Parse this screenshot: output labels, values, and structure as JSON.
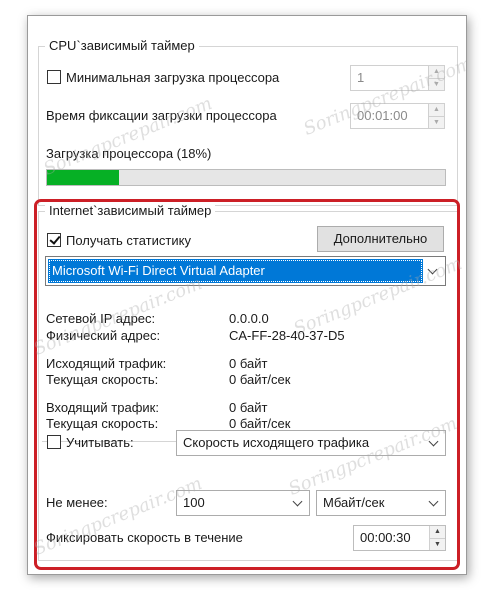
{
  "cpu_group": {
    "title": "CPU`зависимый таймер",
    "min_load_checkbox": {
      "label": "Минимальная загрузка процессора",
      "checked": false
    },
    "min_load_value": "1",
    "fix_time_label": "Время фиксации загрузки процессора",
    "fix_time_value": "00:01:00",
    "load_label": "Загрузка процессора (18%)",
    "load_progress_percent": 18
  },
  "internet_group": {
    "title": "Internet`зависимый таймер",
    "stats_checkbox": {
      "label": "Получать статистику",
      "checked": true
    },
    "more_button": "Дополнительно",
    "adapter_selected": "Microsoft Wi-Fi Direct Virtual Adapter",
    "ip_label": "Сетевой IP адрес:",
    "ip_value": "0.0.0.0",
    "mac_label": "Физический адрес:",
    "mac_value": "CA-FF-28-40-37-D5",
    "out_traffic_label": "Исходящий трафик:",
    "out_traffic_value": "0 байт",
    "out_speed_label": "Текущая скорость:",
    "out_speed_value": "0 байт/сек",
    "in_traffic_label": "Входящий трафик:",
    "in_traffic_value": "0 байт",
    "in_speed_label": "Текущая скорость:",
    "in_speed_value": "0 байт/сек",
    "account_checkbox": {
      "label": "Учитывать:",
      "checked": false
    },
    "account_select": "Скорость исходящего трафика",
    "min_label": "Не менее:",
    "min_value": "100",
    "unit_select": "Мбайт/сек",
    "fix_speed_label": "Фиксировать скорость в течение",
    "fix_speed_value": "00:00:30"
  },
  "watermark": "Soringpcrepair.com",
  "colors": {
    "progress": "#06b025",
    "selection": "#0078d7",
    "highlight_frame": "#cc1f26"
  }
}
